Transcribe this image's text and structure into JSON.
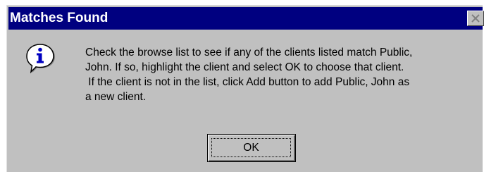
{
  "window": {
    "title": "Matches Found",
    "close_icon": "close-icon",
    "colors": {
      "titlebar": "#000080",
      "face": "#c0c0c0"
    }
  },
  "dialog": {
    "icon": "info-icon",
    "message_lines": [
      "Check the browse list to see if any of the clients listed match Public,",
      "John. If so, highlight the client and select OK to choose that client.",
      " If the client is not in the list, click Add button to add Public, John as",
      "a new client."
    ],
    "ok_label": "OK"
  }
}
